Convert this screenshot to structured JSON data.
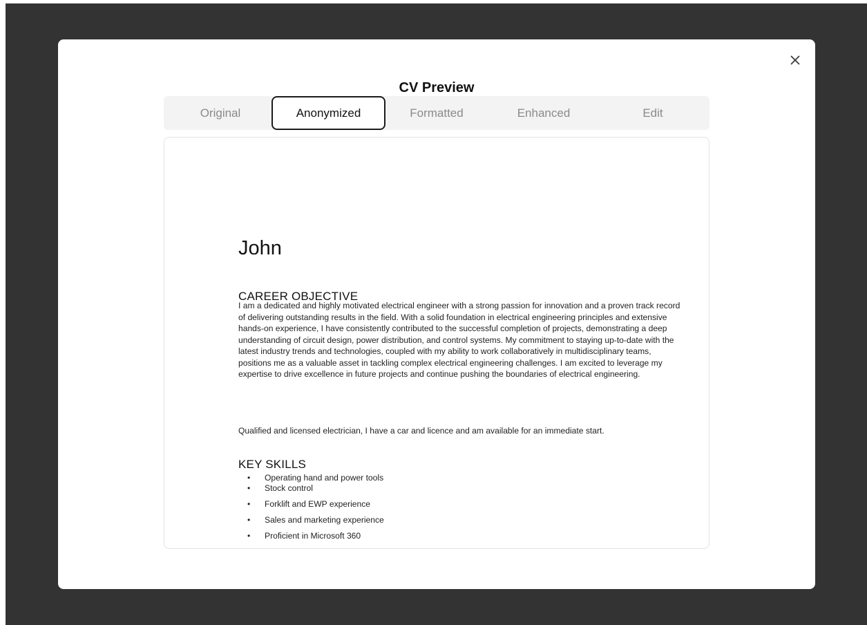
{
  "modal": {
    "title": "CV Preview",
    "close_icon": "close-icon",
    "tabs": [
      {
        "label": "Original",
        "active": false
      },
      {
        "label": "Anonymized",
        "active": true
      },
      {
        "label": "Formatted",
        "active": false
      },
      {
        "label": "Enhanced",
        "active": false
      },
      {
        "label": "Edit",
        "active": false
      }
    ]
  },
  "cv": {
    "name": "John",
    "career_objective_heading": "CAREER OBJECTIVE",
    "career_objective_text": "I am a dedicated and highly motivated electrical engineer with a strong passion for innovation and a proven track record of delivering outstanding results in the field. With a solid foundation in electrical engineering principles and extensive hands-on experience, I have consistently contributed to the successful completion of projects, demonstrating a deep understanding of circuit design, power distribution, and control systems. My commitment to staying up-to-date with the latest industry trends and technologies, coupled with my ability to work collaboratively in multidisciplinary teams, positions me as a valuable asset in tackling complex electrical engineering challenges. I am excited to leverage my expertise to drive excellence in future projects and continue pushing the boundaries of electrical engineering.",
    "career_objective_extra": "Qualified and licensed electrician, I have a car and licence and am available for an immediate start.",
    "key_skills_heading": "KEY SKILLS",
    "key_skills": [
      "Operating hand and power tools",
      "Stock control",
      "Forklift and EWP experience",
      "Sales and marketing experience",
      "Proficient in Microsoft 360"
    ]
  },
  "colors": {
    "backdrop": "#333333",
    "modal_bg": "#ffffff",
    "tab_bar_bg": "#f3f3f3",
    "tab_inactive_text": "#8a8a8a",
    "tab_active_border": "#1a1a1a"
  }
}
